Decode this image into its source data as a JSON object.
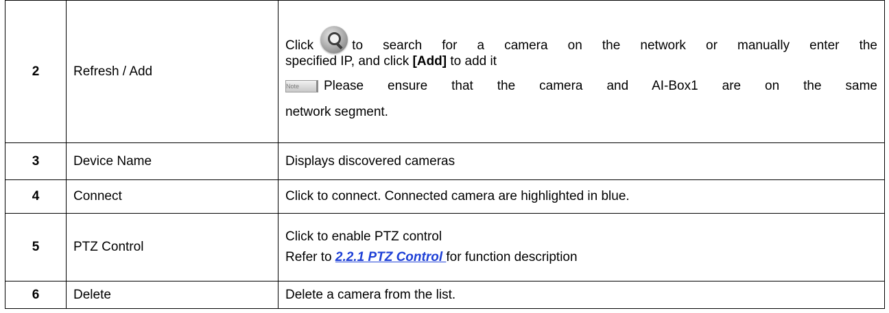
{
  "rows": [
    {
      "number": "2",
      "name": "Refresh / Add",
      "desc": {
        "line1_pre": "Click",
        "line1_post": "to search for a camera on the network or manually enter the",
        "line2_pre": "specified IP, and click ",
        "line2_bold": "[Add]",
        "line2_post": " to add it",
        "note_badge_label": "Note",
        "note_text_line1": "Please ensure that the camera and AI-Box1 are on the same",
        "note_text_line2": "network segment."
      },
      "icons": {
        "search": "search-refresh-icon",
        "note": "note-icon"
      }
    },
    {
      "number": "3",
      "name": "Device Name",
      "desc": {
        "text": "Displays discovered cameras"
      }
    },
    {
      "number": "4",
      "name": "Connect",
      "desc": {
        "text": "Click to connect. Connected camera are highlighted in blue."
      }
    },
    {
      "number": "5",
      "name": "PTZ Control",
      "desc": {
        "line1": "Click to enable PTZ control",
        "line2_pre": "Refer to ",
        "line2_link": "2.2.1 PTZ Control ",
        "line2_post": "for function description"
      }
    },
    {
      "number": "6",
      "name": "Delete",
      "desc": {
        "text": "Delete a camera from the list."
      }
    }
  ],
  "colors": {
    "link": "#1d3fd6",
    "border": "#000000",
    "text": "#000000"
  }
}
